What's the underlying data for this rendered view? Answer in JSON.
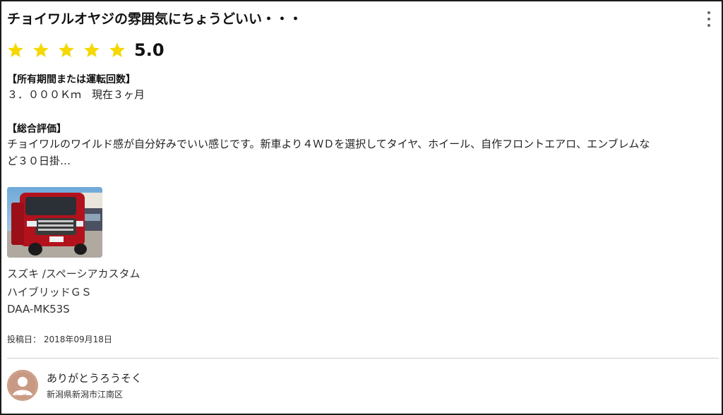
{
  "review": {
    "title": "チョイワルオヤジの雰囲気にちょうどいい・・・",
    "rating": {
      "stars": 5,
      "score": "5.0",
      "star_color": "#f5d800"
    },
    "ownership_label": "【所有期間または運転回数】",
    "ownership_value": "３．０００Ｋｍ　現在３ヶ月",
    "overall_label": "【総合評価】",
    "overall_text_line1": "チョイワルのワイルド感が自分好みでいい感じです。新車より４ＷＤを選択してタイヤ、ホイール、自作フロントエアロ、エンブレムな",
    "overall_text_line2": "ど３０日掛…",
    "photo_icon": "car-photo",
    "car": {
      "make_model": "スズキ /スペーシアカスタム",
      "grade": "ハイブリッドＧＳ",
      "model_code": "DAA-MK53S"
    },
    "posted_label": "投稿日：",
    "posted_date": "2018年09月18日"
  },
  "user": {
    "name": "ありがとうろうそく",
    "location": "新潟県新潟市江南区",
    "avatar_label": "ユーザー",
    "avatar_color": "#c99a83"
  },
  "menu_icon": "more-vertical-icon"
}
